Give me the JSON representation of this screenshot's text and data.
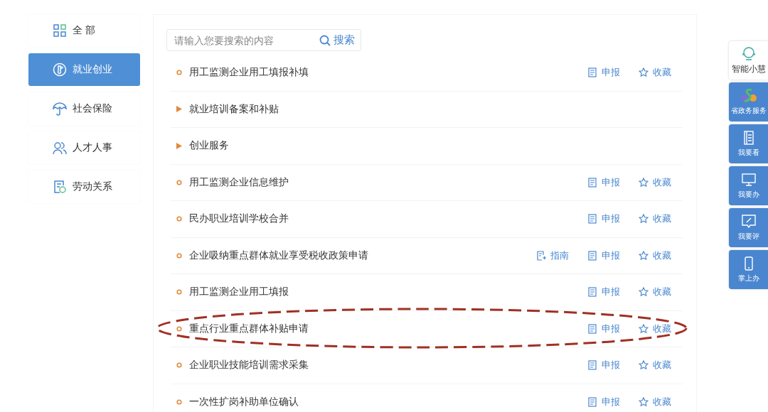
{
  "sidebar": {
    "items": [
      {
        "label": "全 部",
        "selected": false
      },
      {
        "label": "就业创业",
        "selected": true
      },
      {
        "label": "社会保险",
        "selected": false
      },
      {
        "label": "人才人事",
        "selected": false
      },
      {
        "label": "劳动关系",
        "selected": false
      }
    ]
  },
  "search": {
    "placeholder": "请输入您要搜索的内容",
    "button": "搜索"
  },
  "rows": [
    {
      "kind": "item",
      "title": "用工监测企业用工填报补填",
      "annotated": false,
      "actions": [
        {
          "kind": "apply",
          "label": "申报"
        },
        {
          "kind": "favorite",
          "label": "收藏"
        }
      ]
    },
    {
      "kind": "folder",
      "title": "就业培训备案和补贴",
      "annotated": false
    },
    {
      "kind": "folder",
      "title": "创业服务",
      "annotated": false
    },
    {
      "kind": "item",
      "title": "用工监测企业信息维护",
      "annotated": false,
      "actions": [
        {
          "kind": "apply",
          "label": "申报"
        },
        {
          "kind": "favorite",
          "label": "收藏"
        }
      ]
    },
    {
      "kind": "item",
      "title": "民办职业培训学校合并",
      "annotated": false,
      "actions": [
        {
          "kind": "apply",
          "label": "申报"
        },
        {
          "kind": "favorite",
          "label": "收藏"
        }
      ]
    },
    {
      "kind": "item",
      "title": "企业吸纳重点群体就业享受税收政策申请",
      "annotated": false,
      "actions": [
        {
          "kind": "guide",
          "label": "指南"
        },
        {
          "kind": "apply",
          "label": "申报"
        },
        {
          "kind": "favorite",
          "label": "收藏"
        }
      ]
    },
    {
      "kind": "item",
      "title": "用工监测企业用工填报",
      "annotated": false,
      "actions": [
        {
          "kind": "apply",
          "label": "申报"
        },
        {
          "kind": "favorite",
          "label": "收藏"
        }
      ]
    },
    {
      "kind": "item",
      "title": "重点行业重点群体补贴申请",
      "annotated": true,
      "actions": [
        {
          "kind": "apply",
          "label": "申报"
        },
        {
          "kind": "favorite",
          "label": "收藏"
        }
      ]
    },
    {
      "kind": "item",
      "title": "企业职业技能培训需求采集",
      "annotated": false,
      "actions": [
        {
          "kind": "apply",
          "label": "申报"
        },
        {
          "kind": "favorite",
          "label": "收藏"
        }
      ]
    },
    {
      "kind": "item",
      "title": "一次性扩岗补助单位确认",
      "annotated": false,
      "actions": [
        {
          "kind": "apply",
          "label": "申报"
        },
        {
          "kind": "favorite",
          "label": "收藏"
        }
      ]
    }
  ],
  "floating_bar": [
    {
      "kind": "assistant",
      "label": "智能小慧"
    },
    {
      "kind": "logo",
      "label": "省政务服务"
    },
    {
      "kind": "book",
      "label": "我要看"
    },
    {
      "kind": "monitor",
      "label": "我要办"
    },
    {
      "kind": "comment",
      "label": "我要评"
    },
    {
      "kind": "phone",
      "label": "掌上办"
    }
  ]
}
